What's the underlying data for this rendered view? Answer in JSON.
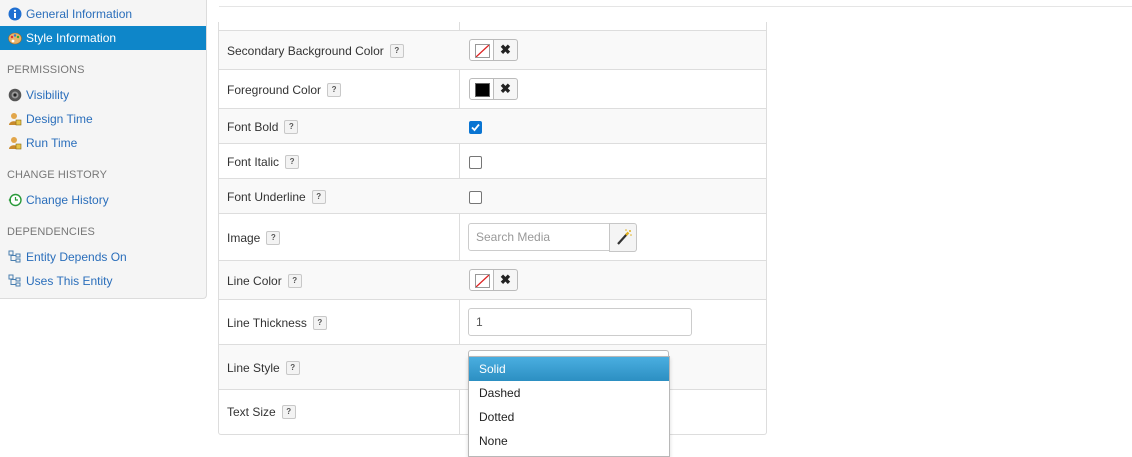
{
  "sidebar": {
    "items_top": [
      {
        "label": "General Information",
        "icon": "info-icon",
        "active": false
      },
      {
        "label": "Style Information",
        "icon": "palette-icon",
        "active": true
      }
    ],
    "sections": [
      {
        "title": "PERMISSIONS",
        "items": [
          {
            "label": "Visibility",
            "icon": "eye-icon"
          },
          {
            "label": "Design Time",
            "icon": "user-lock-icon"
          },
          {
            "label": "Run Time",
            "icon": "user-lock-icon"
          }
        ]
      },
      {
        "title": "CHANGE HISTORY",
        "items": [
          {
            "label": "Change History",
            "icon": "history-icon"
          }
        ]
      },
      {
        "title": "DEPENDENCIES",
        "items": [
          {
            "label": "Entity Depends On",
            "icon": "hierarchy-icon"
          },
          {
            "label": "Uses This Entity",
            "icon": "hierarchy-icon"
          }
        ]
      }
    ]
  },
  "help_glyph": "?",
  "properties": {
    "secondary_bg": {
      "label": "Secondary Background Color",
      "value": "none"
    },
    "foreground": {
      "label": "Foreground Color",
      "value": "#000000"
    },
    "font_bold": {
      "label": "Font Bold",
      "checked": true
    },
    "font_italic": {
      "label": "Font Italic",
      "checked": false
    },
    "font_underline": {
      "label": "Font Underline",
      "checked": false
    },
    "image": {
      "label": "Image",
      "placeholder": "Search Media"
    },
    "line_color": {
      "label": "Line Color",
      "value": "none"
    },
    "line_thickness": {
      "label": "Line Thickness",
      "value": "1"
    },
    "line_style": {
      "label": "Line Style",
      "selected": "Solid"
    },
    "text_size": {
      "label": "Text Size"
    }
  },
  "line_style_options": [
    "Solid",
    "Dashed",
    "Dotted",
    "None"
  ],
  "clear_glyph": "✖",
  "colors": {
    "accent": "#0e86c9",
    "link": "#2a6ebb",
    "checkbox": "#0a75d2"
  }
}
